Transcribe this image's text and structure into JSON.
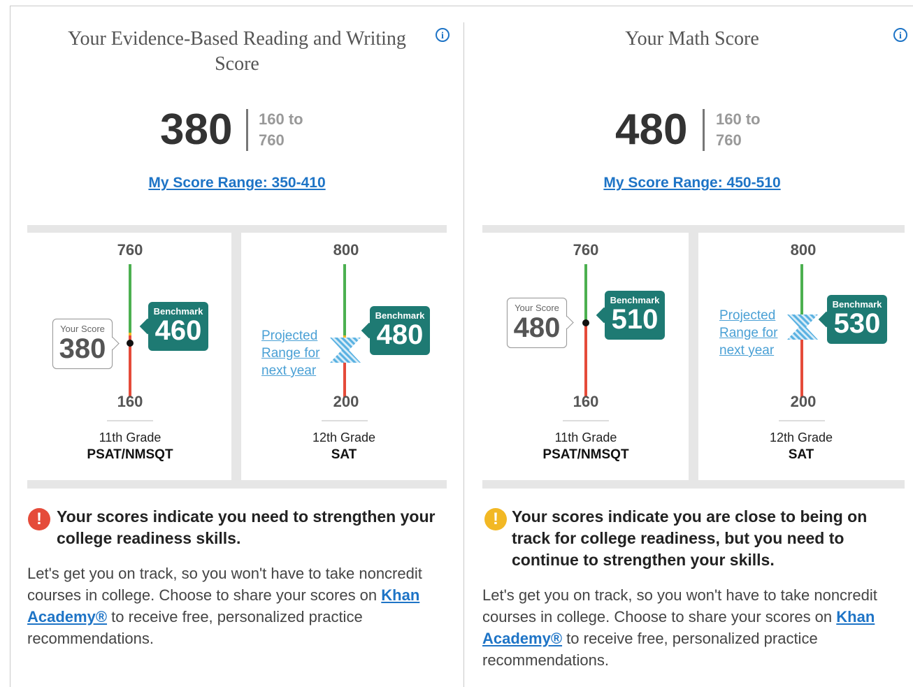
{
  "info_icon_glyph": "i",
  "ebrw": {
    "title": "Your Evidence-Based Reading and Writing Score",
    "score": "380",
    "scale": "160 to 760",
    "score_range_link": "My Score Range: 350-410",
    "psat": {
      "top_tick": "760",
      "bottom_tick": "160",
      "your_score_label": "Your Score",
      "your_score": "380",
      "benchmark_label": "Benchmark",
      "benchmark": "460",
      "grade": "11th Grade",
      "exam": "PSAT/NMSQT"
    },
    "sat": {
      "top_tick": "800",
      "bottom_tick": "200",
      "projected_label": "Projected Range for next year",
      "benchmark_label": "Benchmark",
      "benchmark": "480",
      "grade": "12th Grade",
      "exam": "SAT"
    },
    "alert_icon": "exclamation-red",
    "alert_headline": "Your scores indicate you need to strengthen your college readiness skills.",
    "body_before": "Let's get you on track, so you won't have to take noncredit courses in college. Choose to share your scores on ",
    "khan_link": "Khan Academy®",
    "body_after": " to receive free, personalized practice recommendations."
  },
  "math": {
    "title": "Your Math Score",
    "score": "480",
    "scale": "160 to 760",
    "score_range_link": "My Score Range: 450-510",
    "psat": {
      "top_tick": "760",
      "bottom_tick": "160",
      "your_score_label": "Your Score",
      "your_score": "480",
      "benchmark_label": "Benchmark",
      "benchmark": "510",
      "grade": "11th Grade",
      "exam": "PSAT/NMSQT"
    },
    "sat": {
      "top_tick": "800",
      "bottom_tick": "200",
      "projected_label": "Projected Range for next year",
      "benchmark_label": "Benchmark",
      "benchmark": "530",
      "grade": "12th Grade",
      "exam": "SAT"
    },
    "alert_icon": "exclamation-yellow",
    "alert_headline": "Your scores indicate you are close to being on track for college readiness, but you need to continue to strengthen your skills.",
    "body_before": "Let's get you on track, so you won't have to take noncredit courses in college. Choose to share your scores on ",
    "khan_link": "Khan Academy®",
    "body_after": " to receive free, personalized practice recommendations."
  },
  "colors": {
    "link": "#1e74c6",
    "benchmark_teal": "#1e7a73",
    "above_benchmark_green": "#4cb050",
    "below_benchmark_red": "#e54b3a",
    "warning_yellow": "#f2b824"
  }
}
